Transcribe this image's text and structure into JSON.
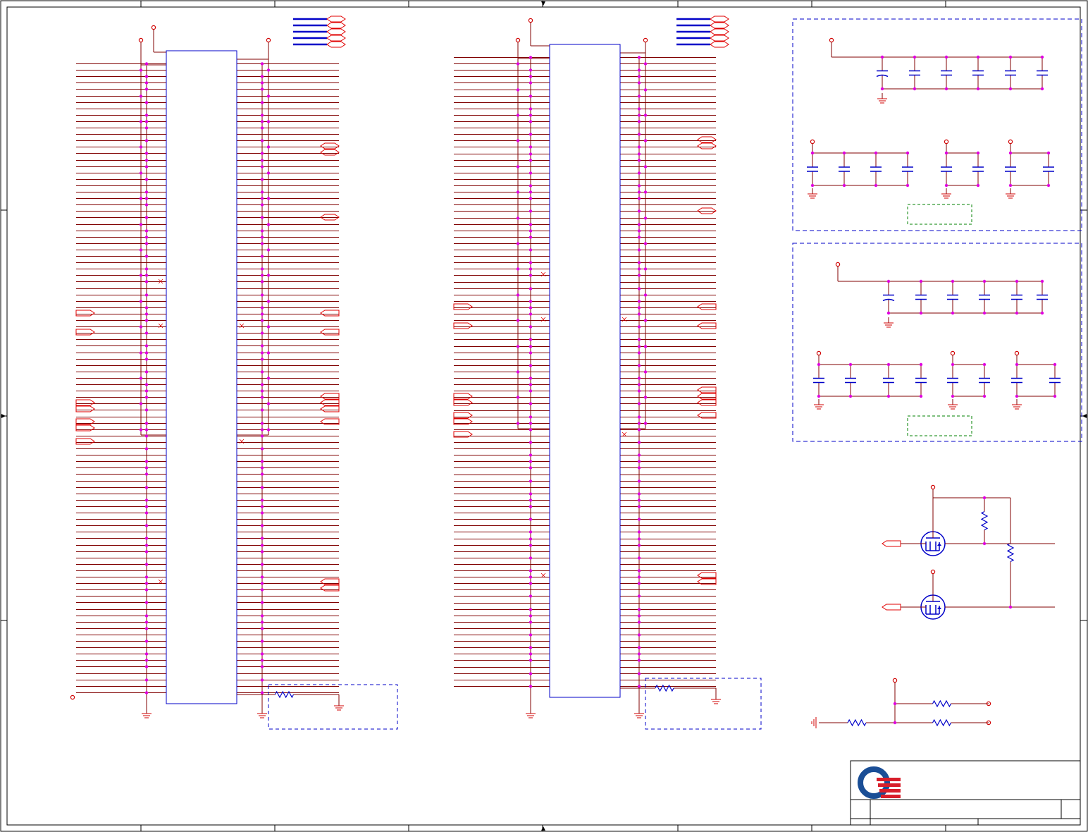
{
  "sheet": {
    "background": "#ffffff",
    "border_color": "#000000",
    "has_title_block": true,
    "has_logo": true
  },
  "colors": {
    "wire": "#800000",
    "component_outline": "#0000c8",
    "power_symbol": "#d00000",
    "junction": "#e000e0",
    "port_outline": "#e00000",
    "bus_line": "#0000c8",
    "dashed_box": "#0000c8",
    "note_box": "#008000",
    "logo_blue": "#1a4e96",
    "logo_red": "#d81e2a"
  },
  "icons": {
    "logo": "company-logo-icon",
    "mosfet": "mosfet-icon",
    "resistor": "resistor-icon",
    "capacitor": "capacitor-icon",
    "ground": "ground-icon",
    "power": "power-port-icon",
    "port": "signal-port-icon"
  },
  "schematic": {
    "connectors": 2,
    "mosfets": 2
  }
}
